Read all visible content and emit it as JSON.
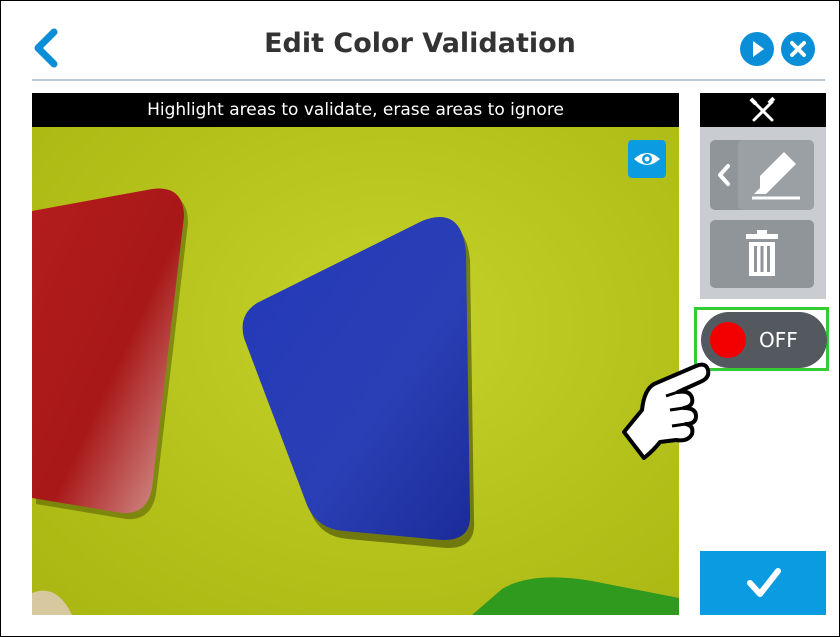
{
  "header": {
    "title": "Edit Color Validation"
  },
  "camera": {
    "instruction": "Highlight areas to validate, erase areas to ignore"
  },
  "tools": {
    "header_icon": "tools-icon",
    "pen_icon": "highlighter-pen-icon",
    "trash_icon": "trash-icon"
  },
  "toggle": {
    "label": "OFF",
    "state": "off",
    "knob_color": "#f20000"
  },
  "colors": {
    "accent": "#0a9be0",
    "highlight_border": "#33cc33",
    "background_surface": "#b7c51b"
  }
}
